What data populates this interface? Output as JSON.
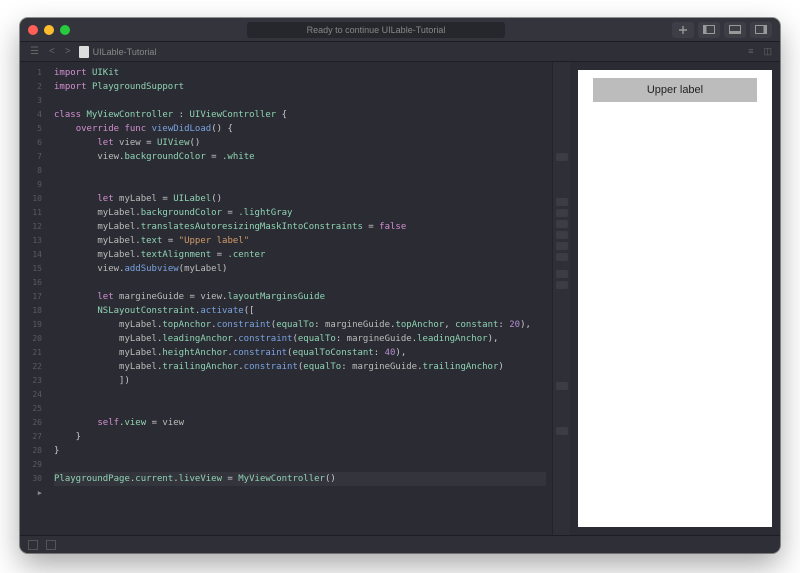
{
  "titlebar": {
    "status": "Ready to continue UILable-Tutorial"
  },
  "nav": {
    "filename": "UILable-Tutorial"
  },
  "preview": {
    "label_text": "Upper label"
  },
  "tokens": {
    "import": "import",
    "class": "class",
    "override": "override",
    "func": "func",
    "let": "let",
    "false": "false",
    "self": "self",
    "UIKit": "UIKit",
    "PlaygroundSupport": "PlaygroundSupport",
    "MyViewController": "MyViewController",
    "UIViewController": "UIViewController",
    "viewDidLoad": "viewDidLoad",
    "UIView": "UIView",
    "UILabel": "UILabel",
    "view": "view",
    "myLabel": "myLabel",
    "margineGuide": "margineGuide",
    "backgroundColor": "backgroundColor",
    "white": ".white",
    "lightGray": ".lightGray",
    "tamic": "translatesAutoresizingMaskIntoConstraints",
    "text": "text",
    "upper_label_str": "\"Upper label\"",
    "textAlignment": "textAlignment",
    "center": ".center",
    "addSubview": "addSubview",
    "layoutMarginsGuide": "layoutMarginsGuide",
    "NSLayoutConstraint": "NSLayoutConstraint",
    "activate": "activate",
    "topAnchor": "topAnchor",
    "constraint": "constraint",
    "equalTo": "equalTo",
    "constant": "constant",
    "twenty": "20",
    "leadingAnchor": "leadingAnchor",
    "heightAnchor": "heightAnchor",
    "equalToConstant": "equalToConstant",
    "forty": "40",
    "trailingAnchor": "trailingAnchor",
    "PlaygroundPage": "PlaygroundPage",
    "current": "current",
    "liveView": "liveView"
  },
  "line_count": 30
}
